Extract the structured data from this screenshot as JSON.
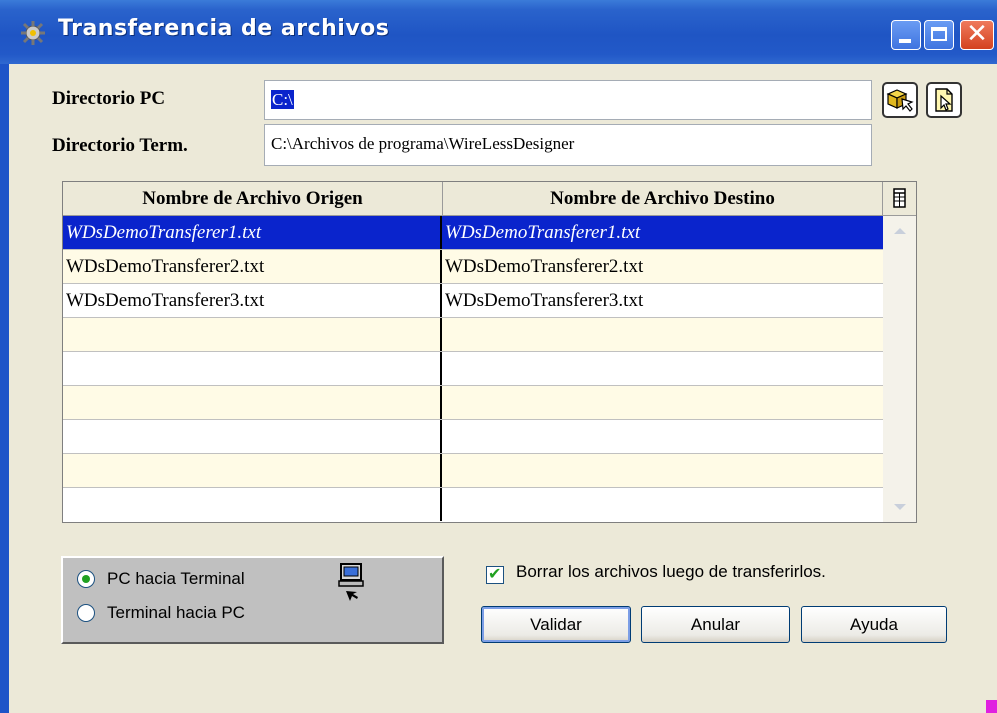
{
  "window": {
    "title": "Transferencia de archivos",
    "close_glyph": "✕"
  },
  "form": {
    "pc_dir_label": "Directorio PC",
    "pc_dir_value": "C:\\",
    "term_dir_label": "Directorio Term.",
    "term_dir_value": "C:\\Archivos de programa\\WireLessDesigner"
  },
  "grid": {
    "columns": [
      "Nombre de Archivo Origen",
      "Nombre de Archivo Destino"
    ],
    "rows": [
      {
        "origen": "WDsDemoTransferer1.txt",
        "destino": "WDsDemoTransferer1.txt"
      },
      {
        "origen": "WDsDemoTransferer2.txt",
        "destino": "WDsDemoTransferer2.txt"
      },
      {
        "origen": "WDsDemoTransferer3.txt",
        "destino": "WDsDemoTransferer3.txt"
      },
      {
        "origen": "",
        "destino": ""
      },
      {
        "origen": "",
        "destino": ""
      },
      {
        "origen": "",
        "destino": ""
      },
      {
        "origen": "",
        "destino": ""
      },
      {
        "origen": "",
        "destino": ""
      },
      {
        "origen": "",
        "destino": ""
      }
    ]
  },
  "direction": {
    "options": [
      "PC hacia Terminal",
      "Terminal hacia PC"
    ],
    "selected": "PC hacia Terminal"
  },
  "delete_after": {
    "label": "Borrar los archivos luego de transferirlos.",
    "checked": true
  },
  "buttons": {
    "validate": "Validar",
    "cancel": "Anular",
    "help": "Ayuda"
  },
  "colors": {
    "titlebar": "#1f55c4",
    "selection": "#0a24cc",
    "row_alt": "#fffbe6",
    "dialog_bg": "#ece9d8"
  }
}
